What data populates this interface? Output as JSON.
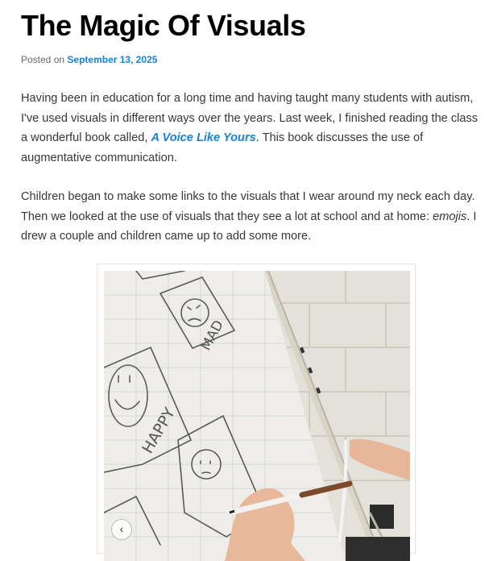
{
  "post": {
    "title": "The Magic Of Visuals",
    "posted_on": "Posted on",
    "date": "September 13, 2025",
    "p1": {
      "before": "Having been in education for a long time and having taught many students with autism, I've used visuals in different ways over the years. Last week, I finished reading the class a wonderful book called, ",
      "link": "A Voice Like Yours",
      "after": ". This book discusses the use of augmentative communication."
    },
    "p2": {
      "before": "Children began to make some links to the visuals that I wear around my neck each day. Then we looked at the use of visuals that they see a lot at school and at home: ",
      "em": "emojis",
      "after": ". I drew a couple and children came up to add some more."
    }
  },
  "photo": {
    "words": [
      "MAD",
      "HAPPY"
    ]
  },
  "gallery": {
    "prev_icon": "chevron-left-icon",
    "prev_glyph": "‹"
  },
  "colors": {
    "link": "#1982d1",
    "title": "#000000",
    "body_text": "#373737"
  }
}
